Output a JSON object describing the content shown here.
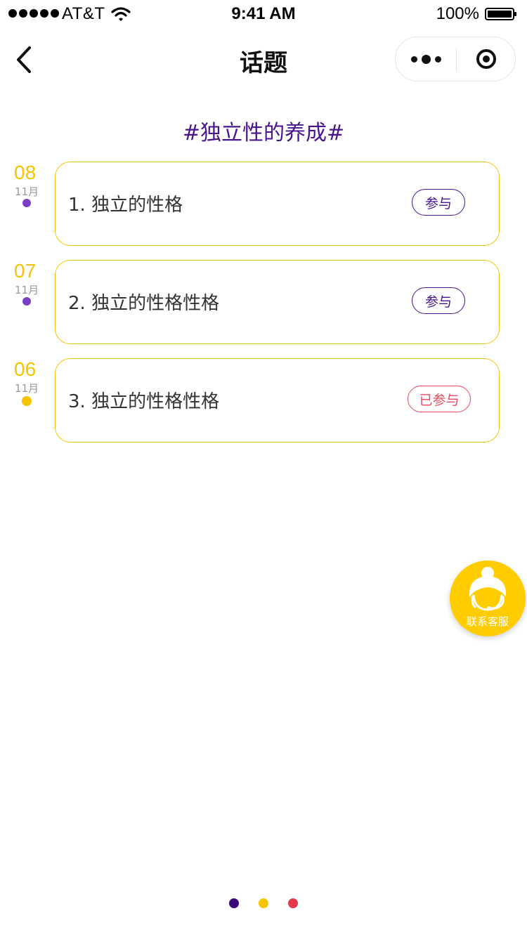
{
  "status_bar": {
    "carrier": "AT&T",
    "time": "9:41 AM",
    "battery": "100%"
  },
  "nav": {
    "title": "话题"
  },
  "topic": {
    "heading": "#独立性的养成#"
  },
  "items": [
    {
      "day": "08",
      "month": "11月",
      "title": "1. 独立的性格",
      "action": "参与",
      "status": "open",
      "dot_color": "#7b3fc4"
    },
    {
      "day": "07",
      "month": "11月",
      "title": "2. 独立的性格性格",
      "action": "参与",
      "status": "open",
      "dot_color": "#7b3fc4"
    },
    {
      "day": "06",
      "month": "11月",
      "title": "3. 独立的性格性格",
      "action": "已参与",
      "status": "done",
      "dot_color": "#f5c400"
    }
  ],
  "service": {
    "label": "联系客服"
  },
  "pager": {
    "dots": [
      "#3a0a7a",
      "#f5c400",
      "#e8394a"
    ]
  },
  "colors": {
    "accent_yellow": "#f5c400",
    "accent_purple": "#4a148c",
    "accent_red": "#e84a5f"
  }
}
